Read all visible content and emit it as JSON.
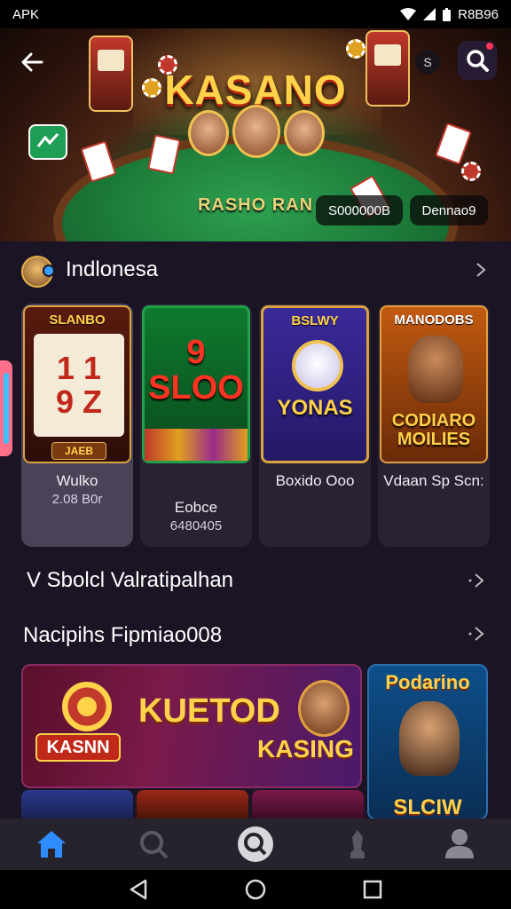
{
  "status_bar": {
    "carrier": "APK",
    "battery_text": "R8B96"
  },
  "hero": {
    "title": "KASANO",
    "subtitle": "RASHO RAN",
    "pill_left": "S000000B",
    "pill_right": "Dennao9",
    "badge": "S"
  },
  "section_indonesia": {
    "title": "Indlonesa"
  },
  "games": [
    {
      "art_label": "SLANBO",
      "art_main": "1 1\n9 Z",
      "banner": "JAEB",
      "name": "Wulko",
      "meta": "2.08 B0r"
    },
    {
      "art_label": "",
      "art_main": "9\nSLOO",
      "banner": "",
      "name": "Eobce",
      "meta": "6480405"
    },
    {
      "art_label": "BSLWY",
      "art_main": "YONAS",
      "banner": "",
      "name": "Boxido Ooo",
      "meta": ""
    },
    {
      "art_label": "MANODOBS",
      "art_main": "CODIARO\nMOILIES",
      "banner": "",
      "name": "Vdaan Sp Scn:",
      "meta": ""
    }
  ],
  "section_second": {
    "title": "V Sbolcl Valratipalhan"
  },
  "section_third": {
    "title": "Nacipihs Fipmiao008"
  },
  "banner_main": {
    "left_label": "KASNN",
    "title": "KUETOD",
    "subtitle": "KASING"
  },
  "banner_side": {
    "title": "Podarino",
    "footer": "SLCIW"
  },
  "nav": [
    "home",
    "search",
    "explore",
    "games",
    "profile"
  ],
  "colors": {
    "accent": "#2f8cff",
    "gold": "#ffd24a",
    "background": "#1b1424"
  }
}
